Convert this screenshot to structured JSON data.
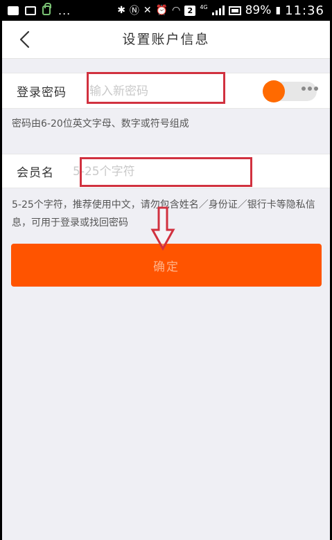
{
  "status_bar": {
    "left_dots": "...",
    "sim_badge": "2",
    "network_type": "4G",
    "battery": "89%",
    "time": "11:36"
  },
  "nav": {
    "title": "设置账户信息",
    "back_icon": "chevron-left-icon"
  },
  "password": {
    "label": "登录密码",
    "placeholder": "输入新密码",
    "value": "",
    "hint": "密码由6-20位英文字母、数字或符号组成"
  },
  "member": {
    "label": "会员名",
    "placeholder": "5-25个字符",
    "value": "",
    "hint": "5-25个字符，推荐使用中文，请勿包含姓名／身份证／银行卡等隐私信息，可用于登录或找回密码"
  },
  "confirm": {
    "label": "确定"
  },
  "colors": {
    "accent": "#ff5400",
    "toggle_knob": "#ff6a00",
    "annotation": "#d1313f",
    "background": "#efeff4"
  }
}
